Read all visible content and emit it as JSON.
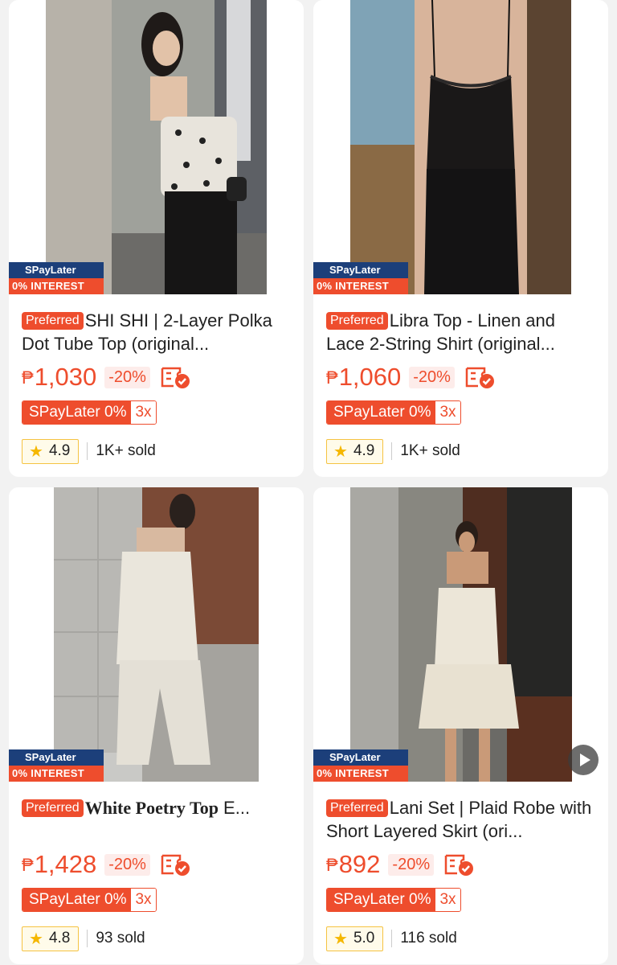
{
  "products": [
    {
      "badge_top": "SPayLater",
      "badge_bottom": "0% INTEREST",
      "tag": "Preferred",
      "title": "SHI SHI | 2-Layer Polka Dot Tube Top (original...",
      "title_style": "normal",
      "currency": "₱",
      "price": "1,030",
      "discount": "-20%",
      "spaylater_label": "SPayLater 0%",
      "spaylater_installment": "3x",
      "rating": "4.9",
      "sold": "1K+ sold",
      "has_video": false
    },
    {
      "badge_top": "SPayLater",
      "badge_bottom": "0% INTEREST",
      "tag": "Preferred",
      "title": "Libra Top - Linen and Lace 2-String Shirt (original...",
      "title_style": "normal",
      "currency": "₱",
      "price": "1,060",
      "discount": "-20%",
      "spaylater_label": "SPayLater 0%",
      "spaylater_installment": "3x",
      "rating": "4.9",
      "sold": "1K+ sold",
      "has_video": false
    },
    {
      "badge_top": "SPayLater",
      "badge_bottom": "0% INTEREST",
      "tag": "Preferred",
      "title_serif": "White Poetry Top",
      "title_rest": " E...",
      "title_style": "serif",
      "currency": "₱",
      "price": "1,428",
      "discount": "-20%",
      "spaylater_label": "SPayLater 0%",
      "spaylater_installment": "3x",
      "rating": "4.8",
      "sold": "93 sold",
      "has_video": false
    },
    {
      "badge_top": "SPayLater",
      "badge_bottom": "0% INTEREST",
      "tag": "Preferred",
      "title": "Lani Set | Plaid Robe with Short Layered Skirt (ori...",
      "title_style": "normal",
      "currency": "₱",
      "price": "892",
      "discount": "-20%",
      "spaylater_label": "SPayLater 0%",
      "spaylater_installment": "3x",
      "rating": "5.0",
      "sold": "116 sold",
      "has_video": true
    }
  ],
  "icons": {
    "voucher": "voucher-check-icon",
    "star": "star-icon",
    "play": "play-icon"
  },
  "colors": {
    "accent": "#ee4d2d",
    "spay_blue": "#1c3f7a",
    "star": "#f5b700"
  }
}
